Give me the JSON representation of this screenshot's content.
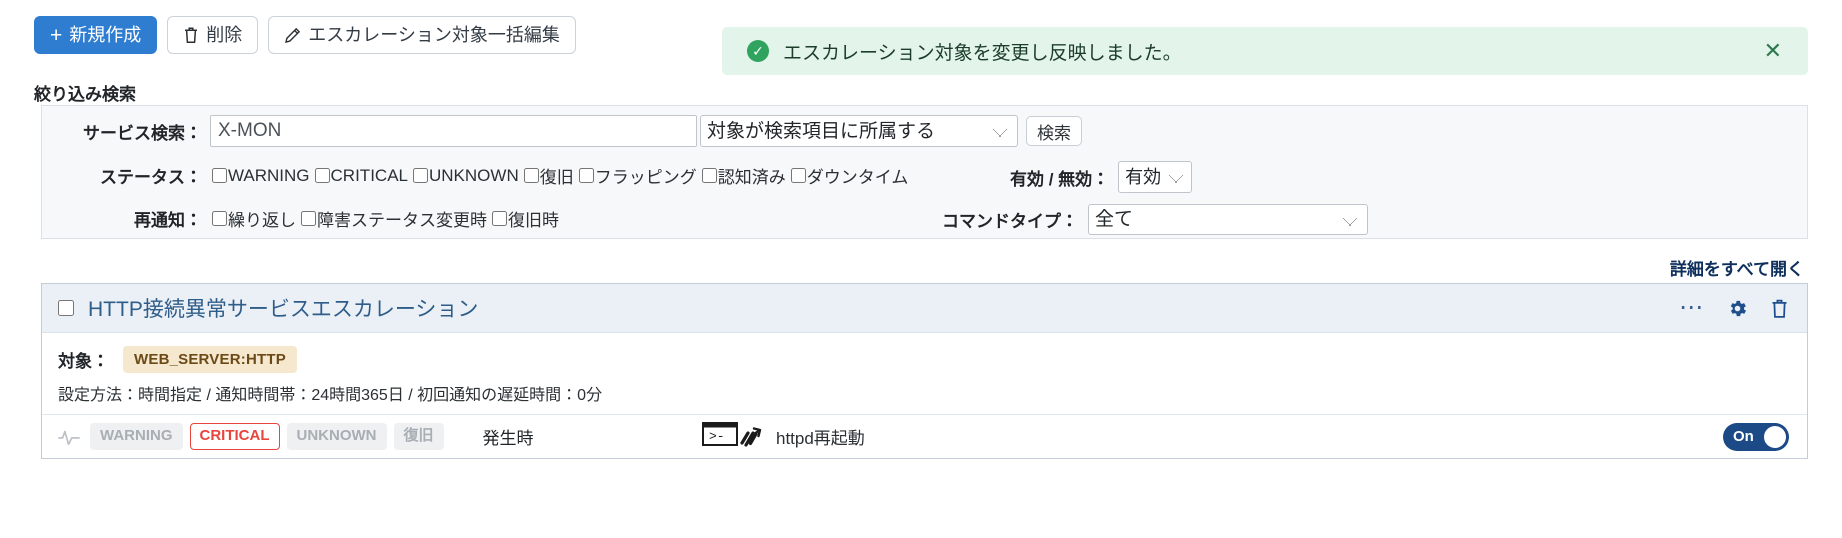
{
  "toolbar": {
    "create_label": "新規作成",
    "create_icon": "plus-icon",
    "delete_label": "削除",
    "delete_icon": "trash-icon",
    "bulk_edit_label": "エスカレーション対象一括編集",
    "bulk_edit_icon": "pencil-icon"
  },
  "alert": {
    "icon": "check-circle-icon",
    "message": "エスカレーション対象を変更し反映しました。",
    "close_icon": "close-icon",
    "bg_color": "#e3f4ea",
    "accent_color": "#30a45e"
  },
  "filter": {
    "title": "絞り込み検索",
    "service_search": {
      "label": "サービス検索：",
      "value": "X-MON",
      "placeholder": "",
      "scope_selected": "対象が検索項目に所属する",
      "scope_options": [
        "対象が検索項目に所属する"
      ],
      "search_button": "検索"
    },
    "status": {
      "label": "ステータス：",
      "items": [
        {
          "label": "WARNING",
          "checked": false
        },
        {
          "label": "CRITICAL",
          "checked": false
        },
        {
          "label": "UNKNOWN",
          "checked": false
        },
        {
          "label": "復旧",
          "checked": false
        },
        {
          "label": "フラッピング",
          "checked": false
        },
        {
          "label": "認知済み",
          "checked": false
        },
        {
          "label": "ダウンタイム",
          "checked": false
        }
      ]
    },
    "enabled": {
      "label": "有効 / 無効：",
      "selected": "有効",
      "options": [
        "有効"
      ]
    },
    "renotify": {
      "label": "再通知：",
      "items": [
        {
          "label": "繰り返し",
          "checked": false
        },
        {
          "label": "障害ステータス変更時",
          "checked": false
        },
        {
          "label": "復旧時",
          "checked": false
        }
      ]
    },
    "command_type": {
      "label": "コマンドタイプ：",
      "selected": "全て",
      "options": [
        "全て"
      ]
    }
  },
  "list": {
    "expand_all_label": "詳細をすべて開く",
    "cards": [
      {
        "checked": false,
        "title": "HTTP接続異常サービスエスカレーション",
        "actions": [
          {
            "icon": "ellipsis-icon",
            "name": "more-actions"
          },
          {
            "icon": "gear-icon",
            "name": "settings"
          },
          {
            "icon": "trash-icon",
            "name": "delete"
          }
        ],
        "target_label": "対象：",
        "target_badge": "WEB_SERVER:HTTP",
        "setting_line": "設定方法：時間指定 / 通知時間帯：24時間365日 / 初回通知の遅延時間：0分",
        "statuses": [
          {
            "label": "WARNING",
            "state": "off"
          },
          {
            "label": "CRITICAL",
            "state": "critical"
          },
          {
            "label": "UNKNOWN",
            "state": "off"
          },
          {
            "label": "復旧",
            "state": "off"
          }
        ],
        "timing": "発生時",
        "command_icon": "terminal-run-icon",
        "command_name": "httpd再起動",
        "toggle": {
          "label": "On",
          "on": true,
          "color": "#1b4a87"
        }
      }
    ]
  }
}
